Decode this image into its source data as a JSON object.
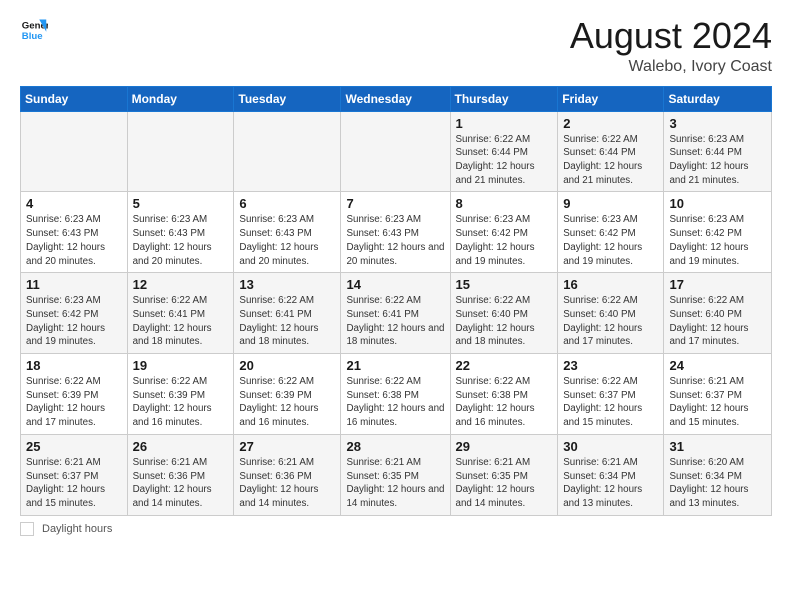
{
  "header": {
    "logo_line1": "General",
    "logo_line2": "Blue",
    "main_title": "August 2024",
    "subtitle": "Walebo, Ivory Coast"
  },
  "calendar": {
    "days_of_week": [
      "Sunday",
      "Monday",
      "Tuesday",
      "Wednesday",
      "Thursday",
      "Friday",
      "Saturday"
    ],
    "weeks": [
      [
        {
          "day": "",
          "info": ""
        },
        {
          "day": "",
          "info": ""
        },
        {
          "day": "",
          "info": ""
        },
        {
          "day": "",
          "info": ""
        },
        {
          "day": "1",
          "info": "Sunrise: 6:22 AM\nSunset: 6:44 PM\nDaylight: 12 hours and 21 minutes."
        },
        {
          "day": "2",
          "info": "Sunrise: 6:22 AM\nSunset: 6:44 PM\nDaylight: 12 hours and 21 minutes."
        },
        {
          "day": "3",
          "info": "Sunrise: 6:23 AM\nSunset: 6:44 PM\nDaylight: 12 hours and 21 minutes."
        }
      ],
      [
        {
          "day": "4",
          "info": "Sunrise: 6:23 AM\nSunset: 6:43 PM\nDaylight: 12 hours and 20 minutes."
        },
        {
          "day": "5",
          "info": "Sunrise: 6:23 AM\nSunset: 6:43 PM\nDaylight: 12 hours and 20 minutes."
        },
        {
          "day": "6",
          "info": "Sunrise: 6:23 AM\nSunset: 6:43 PM\nDaylight: 12 hours and 20 minutes."
        },
        {
          "day": "7",
          "info": "Sunrise: 6:23 AM\nSunset: 6:43 PM\nDaylight: 12 hours and 20 minutes."
        },
        {
          "day": "8",
          "info": "Sunrise: 6:23 AM\nSunset: 6:42 PM\nDaylight: 12 hours and 19 minutes."
        },
        {
          "day": "9",
          "info": "Sunrise: 6:23 AM\nSunset: 6:42 PM\nDaylight: 12 hours and 19 minutes."
        },
        {
          "day": "10",
          "info": "Sunrise: 6:23 AM\nSunset: 6:42 PM\nDaylight: 12 hours and 19 minutes."
        }
      ],
      [
        {
          "day": "11",
          "info": "Sunrise: 6:23 AM\nSunset: 6:42 PM\nDaylight: 12 hours and 19 minutes."
        },
        {
          "day": "12",
          "info": "Sunrise: 6:22 AM\nSunset: 6:41 PM\nDaylight: 12 hours and 18 minutes."
        },
        {
          "day": "13",
          "info": "Sunrise: 6:22 AM\nSunset: 6:41 PM\nDaylight: 12 hours and 18 minutes."
        },
        {
          "day": "14",
          "info": "Sunrise: 6:22 AM\nSunset: 6:41 PM\nDaylight: 12 hours and 18 minutes."
        },
        {
          "day": "15",
          "info": "Sunrise: 6:22 AM\nSunset: 6:40 PM\nDaylight: 12 hours and 18 minutes."
        },
        {
          "day": "16",
          "info": "Sunrise: 6:22 AM\nSunset: 6:40 PM\nDaylight: 12 hours and 17 minutes."
        },
        {
          "day": "17",
          "info": "Sunrise: 6:22 AM\nSunset: 6:40 PM\nDaylight: 12 hours and 17 minutes."
        }
      ],
      [
        {
          "day": "18",
          "info": "Sunrise: 6:22 AM\nSunset: 6:39 PM\nDaylight: 12 hours and 17 minutes."
        },
        {
          "day": "19",
          "info": "Sunrise: 6:22 AM\nSunset: 6:39 PM\nDaylight: 12 hours and 16 minutes."
        },
        {
          "day": "20",
          "info": "Sunrise: 6:22 AM\nSunset: 6:39 PM\nDaylight: 12 hours and 16 minutes."
        },
        {
          "day": "21",
          "info": "Sunrise: 6:22 AM\nSunset: 6:38 PM\nDaylight: 12 hours and 16 minutes."
        },
        {
          "day": "22",
          "info": "Sunrise: 6:22 AM\nSunset: 6:38 PM\nDaylight: 12 hours and 16 minutes."
        },
        {
          "day": "23",
          "info": "Sunrise: 6:22 AM\nSunset: 6:37 PM\nDaylight: 12 hours and 15 minutes."
        },
        {
          "day": "24",
          "info": "Sunrise: 6:21 AM\nSunset: 6:37 PM\nDaylight: 12 hours and 15 minutes."
        }
      ],
      [
        {
          "day": "25",
          "info": "Sunrise: 6:21 AM\nSunset: 6:37 PM\nDaylight: 12 hours and 15 minutes."
        },
        {
          "day": "26",
          "info": "Sunrise: 6:21 AM\nSunset: 6:36 PM\nDaylight: 12 hours and 14 minutes."
        },
        {
          "day": "27",
          "info": "Sunrise: 6:21 AM\nSunset: 6:36 PM\nDaylight: 12 hours and 14 minutes."
        },
        {
          "day": "28",
          "info": "Sunrise: 6:21 AM\nSunset: 6:35 PM\nDaylight: 12 hours and 14 minutes."
        },
        {
          "day": "29",
          "info": "Sunrise: 6:21 AM\nSunset: 6:35 PM\nDaylight: 12 hours and 14 minutes."
        },
        {
          "day": "30",
          "info": "Sunrise: 6:21 AM\nSunset: 6:34 PM\nDaylight: 12 hours and 13 minutes."
        },
        {
          "day": "31",
          "info": "Sunrise: 6:20 AM\nSunset: 6:34 PM\nDaylight: 12 hours and 13 minutes."
        }
      ]
    ]
  },
  "footer": {
    "label": "Daylight hours"
  }
}
